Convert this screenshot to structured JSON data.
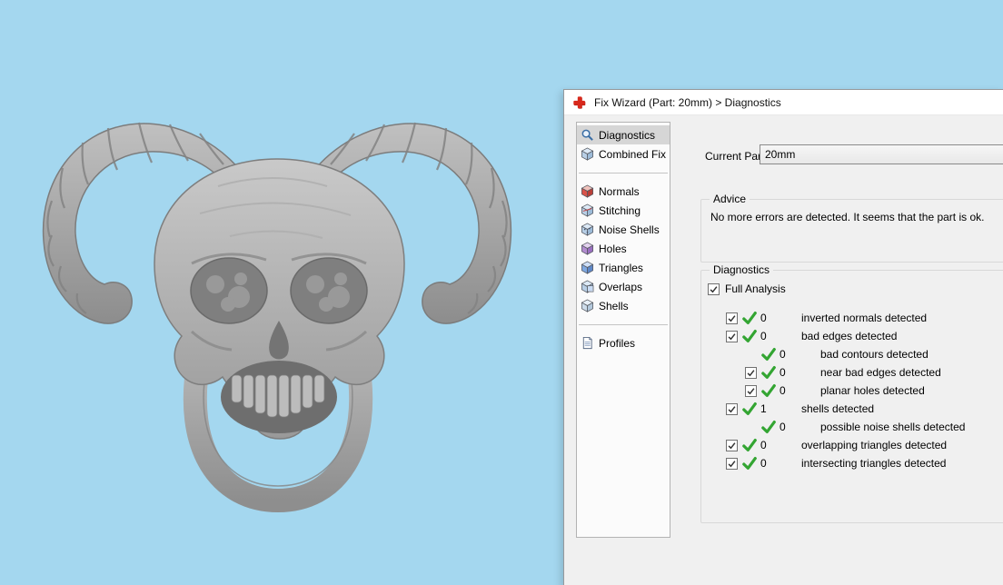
{
  "colors": {
    "viewport_background": "#a4d7ef",
    "check_green": "#33a532",
    "wizard_icon_red": "#d8291c",
    "selected_item_bg": "#d6d6d6"
  },
  "viewport": {
    "description": "3D view showing a gray skull ring with curled ram horns"
  },
  "dialog": {
    "title": "Fix Wizard (Part: 20mm) > Diagnostics",
    "sidebar": {
      "groups": [
        {
          "items": [
            {
              "label": "Diagnostics",
              "icon": "magnifier-icon",
              "selected": true
            },
            {
              "label": "Combined Fix",
              "icon": "cube-icon",
              "selected": false
            }
          ]
        },
        {
          "items": [
            {
              "label": "Normals",
              "icon": "cube-red-icon",
              "selected": false
            },
            {
              "label": "Stitching",
              "icon": "cube-stitch-icon",
              "selected": false
            },
            {
              "label": "Noise Shells",
              "icon": "cube-dots-icon",
              "selected": false
            },
            {
              "label": "Holes",
              "icon": "cube-purple-icon",
              "selected": false
            },
            {
              "label": "Triangles",
              "icon": "cube-blue-icon",
              "selected": false
            },
            {
              "label": "Overlaps",
              "icon": "cube-overlap-icon",
              "selected": false
            },
            {
              "label": "Shells",
              "icon": "cube-shell-icon",
              "selected": false
            }
          ]
        },
        {
          "items": [
            {
              "label": "Profiles",
              "icon": "document-icon",
              "selected": false
            }
          ]
        }
      ]
    },
    "current_part": {
      "label": "Current Part:",
      "value": "20mm"
    },
    "advice": {
      "title": "Advice",
      "text": "No more errors are detected. It seems that the part is ok."
    },
    "diagnostics": {
      "title": "Diagnostics",
      "full_analysis": {
        "label": "Full Analysis",
        "checked": true
      },
      "rows": [
        {
          "checkbox": true,
          "checked": true,
          "ok": true,
          "count": "0",
          "label": "inverted normals detected",
          "indent": 0
        },
        {
          "checkbox": true,
          "checked": true,
          "ok": true,
          "count": "0",
          "label": "bad edges detected",
          "indent": 0
        },
        {
          "checkbox": false,
          "checked": false,
          "ok": true,
          "count": "0",
          "label": "bad contours detected",
          "indent": 1
        },
        {
          "checkbox": true,
          "checked": true,
          "ok": true,
          "count": "0",
          "label": "near bad edges detected",
          "indent": 1
        },
        {
          "checkbox": true,
          "checked": true,
          "ok": true,
          "count": "0",
          "label": "planar holes detected",
          "indent": 1
        },
        {
          "checkbox": true,
          "checked": true,
          "ok": true,
          "count": "1",
          "label": "shells detected",
          "indent": 0
        },
        {
          "checkbox": false,
          "checked": false,
          "ok": true,
          "count": "0",
          "label": "possible noise shells detected",
          "indent": 1
        },
        {
          "checkbox": true,
          "checked": true,
          "ok": true,
          "count": "0",
          "label": "overlapping triangles detected",
          "indent": 0
        },
        {
          "checkbox": true,
          "checked": true,
          "ok": true,
          "count": "0",
          "label": "intersecting triangles detected",
          "indent": 0
        }
      ]
    }
  }
}
